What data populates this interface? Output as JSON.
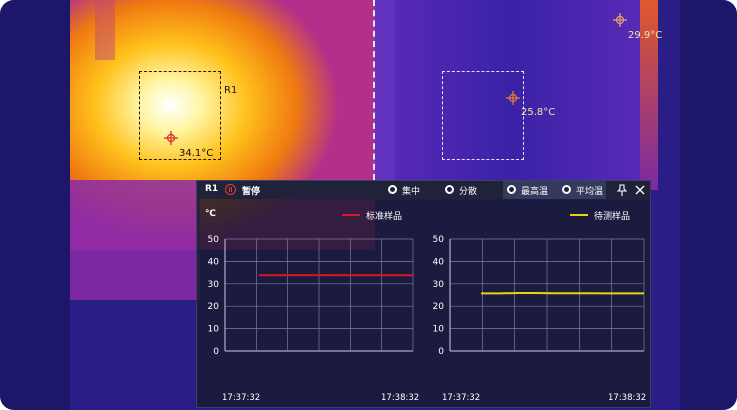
{
  "overlay": {
    "roi_left_label": "R1",
    "roi_left_temp": "34.1°C",
    "roi_right_temp": "25.8°C",
    "corner_temp": "29.9°C"
  },
  "panel": {
    "region": "R1",
    "pause_label": "暂停",
    "options": [
      {
        "label": "集中",
        "selected": false
      },
      {
        "label": "分散",
        "selected": false
      },
      {
        "label": "最高温",
        "selected": false
      },
      {
        "label": "平均温",
        "selected": false
      }
    ],
    "pin_icon": "pin-icon",
    "close_icon": "close-icon",
    "unit": "℃"
  },
  "colors": {
    "standard_series": "#d8181f",
    "test_series": "#e8d40a"
  },
  "chart_data": [
    {
      "type": "line",
      "ylim": [
        0,
        50
      ],
      "yticks": [
        "50",
        "40",
        "30",
        "20",
        "10",
        "0"
      ],
      "x_start": "17:37:32",
      "x_end": "17:38:32",
      "series": [
        {
          "name": "标准样品",
          "values": [
            33.8,
            33.8,
            33.9,
            33.9,
            33.9,
            33.8,
            33.8,
            33.8,
            33.8,
            33.8
          ]
        }
      ]
    },
    {
      "type": "line",
      "ylim": [
        0,
        50
      ],
      "yticks": [
        "50",
        "40",
        "30",
        "20",
        "10",
        "0"
      ],
      "x_start": "17:37:32",
      "x_end": "17:38:32",
      "series": [
        {
          "name": "待测样品",
          "values": [
            25.7,
            25.7,
            25.9,
            25.9,
            25.8,
            25.8,
            25.8,
            25.7,
            25.7,
            25.7
          ]
        }
      ]
    }
  ]
}
